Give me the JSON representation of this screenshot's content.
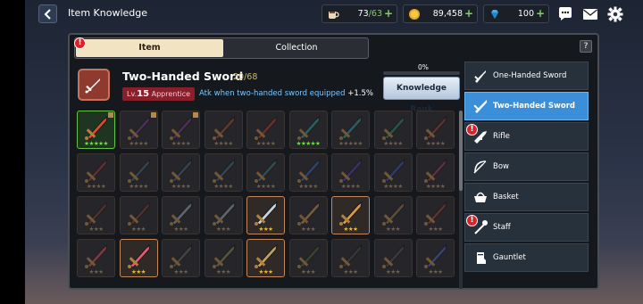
{
  "header": {
    "title": "Item Knowledge",
    "resources": [
      {
        "icon": "coffee-cup-icon",
        "current": "73",
        "max": "/63"
      },
      {
        "icon": "gold-coin-icon",
        "value": "89,458"
      },
      {
        "icon": "diamond-gem-icon",
        "value": "100"
      }
    ],
    "plus_glyph": "+"
  },
  "tabs": {
    "item": "Item",
    "collection": "Collection"
  },
  "help_label": "?",
  "alert_glyph": "!",
  "item": {
    "name": "Two-Handed Sword",
    "count": "20/68",
    "lv_prefix": "Lv.",
    "lv": "15",
    "rank": "Apprentice",
    "effect": "Atk when two-handed sword equipped",
    "effect_bonus": "+1.5%",
    "progress_label": "0%",
    "progress": 0,
    "knowledge_button": "Knowledge Rank"
  },
  "categories": [
    {
      "label": "One-Handed Sword",
      "icon": "sword-icon",
      "active": false,
      "alert": false
    },
    {
      "label": "Two-Handed Sword",
      "icon": "greatsword-icon",
      "active": true,
      "alert": false
    },
    {
      "label": "Rifle",
      "icon": "rifle-icon",
      "active": false,
      "alert": true
    },
    {
      "label": "Bow",
      "icon": "bow-icon",
      "active": false,
      "alert": false
    },
    {
      "label": "Basket",
      "icon": "basket-icon",
      "active": false,
      "alert": false
    },
    {
      "label": "Staff",
      "icon": "staff-icon",
      "active": false,
      "alert": true
    },
    {
      "label": "Gauntlet",
      "icon": "gauntlet-icon",
      "active": false,
      "alert": false
    }
  ],
  "colors": {
    "accent": "#3b8fd8",
    "gold": "#f0b63c",
    "alert": "#d9222a",
    "green": "#7fd35c"
  },
  "grid": [
    [
      {
        "s": 5,
        "c": "green",
        "w": "#d94b32",
        "corner": true
      },
      {
        "s": 4,
        "c": "",
        "w": "#6a3a7a",
        "corner": true
      },
      {
        "s": 4,
        "c": "",
        "w": "#6a3a7a",
        "corner": true
      },
      {
        "s": 4,
        "c": "",
        "w": "#8a4a30"
      },
      {
        "s": 4,
        "c": "",
        "w": "#9a3a2c"
      },
      {
        "s": 5,
        "c": "grn",
        "w": "#2f8c8c"
      },
      {
        "s": 5,
        "c": "",
        "w": "#2f8c8c"
      },
      {
        "s": 4,
        "c": "",
        "w": "#2f7a5a"
      },
      {
        "s": 4,
        "c": "",
        "w": "#8a3a3a"
      }
    ],
    [
      {
        "s": 4,
        "c": "",
        "w": "#8a3a3a"
      },
      {
        "s": 4,
        "c": "",
        "w": "#3e5a70"
      },
      {
        "s": 4,
        "c": "",
        "w": "#3e5a70"
      },
      {
        "s": 4,
        "c": "",
        "w": "#3e6070"
      },
      {
        "s": 4,
        "c": "",
        "w": "#3e6a70"
      },
      {
        "s": 4,
        "c": "",
        "w": "#3c5a9a"
      },
      {
        "s": 4,
        "c": "",
        "w": "#4a3aa0"
      },
      {
        "s": 4,
        "c": "",
        "w": "#3a4aa0"
      },
      {
        "s": 4,
        "c": "",
        "w": "#8a3a4a"
      }
    ],
    [
      {
        "s": 3,
        "c": "",
        "w": "#6a3a30"
      },
      {
        "s": 3,
        "c": "",
        "w": "#6a3a30"
      },
      {
        "s": 3,
        "c": "",
        "w": "#8a9aa8"
      },
      {
        "s": 3,
        "c": "",
        "w": "#8a9aa8"
      },
      {
        "s": 3,
        "c": "owned",
        "w": "#c8d4e0"
      },
      {
        "s": 3,
        "c": "",
        "w": "#b08a50"
      },
      {
        "s": 3,
        "c": "owned",
        "w": "#d89a40"
      },
      {
        "s": 3,
        "c": "",
        "w": "#8a6a40"
      },
      {
        "s": 3,
        "c": "",
        "w": "#8a3a3a"
      }
    ],
    [
      {
        "s": 3,
        "c": "",
        "w": "#c04a50"
      },
      {
        "s": 3,
        "c": "owned",
        "w": "#e05a70"
      },
      {
        "s": 3,
        "c": "",
        "w": "#5a5a50"
      },
      {
        "s": 3,
        "c": "",
        "w": "#7a7a50"
      },
      {
        "s": 3,
        "c": "owned",
        "w": "#c0a060"
      },
      {
        "s": 3,
        "c": "",
        "w": "#4a5a3a"
      },
      {
        "s": 3,
        "c": "",
        "w": "#3a4a3a"
      },
      {
        "s": 3,
        "c": "",
        "w": "#4a4a4a"
      },
      {
        "s": 3,
        "c": "",
        "w": "#4a5a9a"
      }
    ]
  ]
}
